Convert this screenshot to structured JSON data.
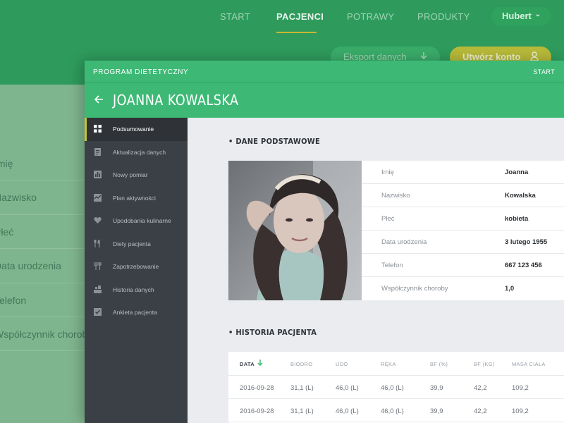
{
  "background": {
    "nav": {
      "items": [
        {
          "label": "START",
          "active": false
        },
        {
          "label": "PACJENCI",
          "active": true
        },
        {
          "label": "POTRAWY",
          "active": false
        },
        {
          "label": "PRODUKTY",
          "active": false
        }
      ],
      "user": "Hubert"
    },
    "actions": {
      "export_label": "Eksport danych",
      "create_label": "Utwórz konto"
    },
    "list_rows": [
      "Imię",
      "Nazwisko",
      "Płeć",
      "Data urodzenia",
      "Telefon",
      "Współczynnik choroby"
    ]
  },
  "modal": {
    "app_name": "PROGRAM DIETETYCZNY",
    "start_link": "START",
    "patient_name": "JOANNA KOWALSKA",
    "sidebar": {
      "items": [
        {
          "label": "Podsumowanie",
          "icon": "grid-icon",
          "active": true
        },
        {
          "label": "Aktualizacja danych",
          "icon": "document-icon",
          "active": false
        },
        {
          "label": "Nowy pomiar",
          "icon": "bar-chart-icon",
          "active": false
        },
        {
          "label": "Plan aktywności",
          "icon": "activity-icon",
          "active": false
        },
        {
          "label": "Upodobania kulinarne",
          "icon": "heart-icon",
          "active": false
        },
        {
          "label": "Diety pacjenta",
          "icon": "cutlery-icon",
          "active": false
        },
        {
          "label": "Zapotrzebowanie",
          "icon": "cutlery-alt-icon",
          "active": false
        },
        {
          "label": "Historia danych",
          "icon": "history-icon",
          "active": false
        },
        {
          "label": "Ankieta pacjenta",
          "icon": "checkbox-icon",
          "active": false
        }
      ]
    },
    "basic_info": {
      "title": "• DANE PODSTAWOWE",
      "rows": [
        {
          "label": "Imię",
          "value": "Joanna"
        },
        {
          "label": "Nazwisko",
          "value": "Kowalska"
        },
        {
          "label": "Płeć",
          "value": "kobieta"
        },
        {
          "label": "Data urodzenia",
          "value": "3 lutego 1955"
        },
        {
          "label": "Telefon",
          "value": "667 123 456"
        },
        {
          "label": "Współczynnik choroby",
          "value": "1,0"
        }
      ]
    },
    "history": {
      "title": "• HISTORIA PACJENTA",
      "columns": [
        "DATA",
        "BIODRO",
        "UDO",
        "RĘKA",
        "BF (%)",
        "BF (KG)",
        "MASA CIAŁA"
      ],
      "rows": [
        [
          "2016-09-28",
          "31,1 (L)",
          "46,0 (L)",
          "46,0 (L)",
          "39,9",
          "42,2",
          "109,2"
        ],
        [
          "2016-09-28",
          "31,1 (L)",
          "46,0 (L)",
          "46,0 (L)",
          "39,9",
          "42,2",
          "109,2"
        ]
      ]
    },
    "colors": {
      "brand_green": "#3db975",
      "sidebar_dark": "#3b4046",
      "accent_yellow": "#c9c135"
    }
  }
}
